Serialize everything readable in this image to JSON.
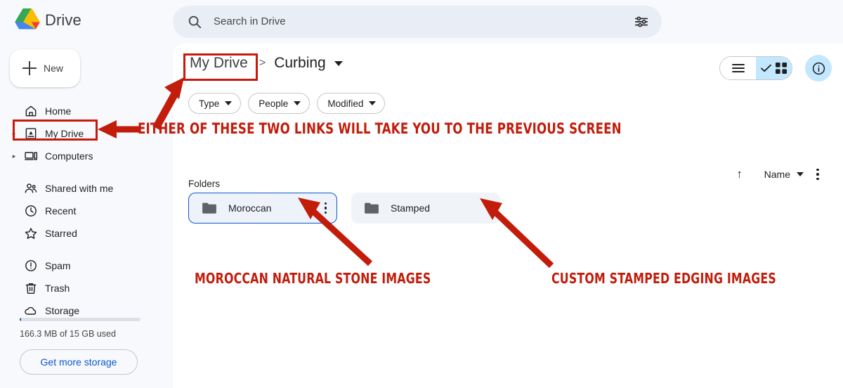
{
  "app": {
    "name": "Drive",
    "logo_icon": "google-drive-logo"
  },
  "search": {
    "placeholder": "Search in Drive",
    "value": "",
    "search_icon": "search-icon",
    "filter_icon": "tune-icon"
  },
  "sidebar": {
    "new_button": {
      "label": "New",
      "icon": "plus-icon"
    },
    "items": [
      {
        "label": "Home",
        "icon": "home-icon",
        "caret": false,
        "selected": false
      },
      {
        "label": "My Drive",
        "icon": "my-drive-icon",
        "caret": true,
        "selected": true
      },
      {
        "label": "Computers",
        "icon": "computers-icon",
        "caret": true,
        "selected": false
      },
      {
        "label": "Shared with me",
        "icon": "people-icon",
        "caret": false,
        "selected": false
      },
      {
        "label": "Recent",
        "icon": "clock-icon",
        "caret": false,
        "selected": false
      },
      {
        "label": "Starred",
        "icon": "star-icon",
        "caret": false,
        "selected": false
      },
      {
        "label": "Spam",
        "icon": "spam-icon",
        "caret": false,
        "selected": false
      },
      {
        "label": "Trash",
        "icon": "trash-icon",
        "caret": false,
        "selected": false
      },
      {
        "label": "Storage",
        "icon": "cloud-icon",
        "caret": false,
        "selected": false
      }
    ],
    "storage": {
      "usage_text": "166.3 MB of 15 GB used",
      "percent": 1,
      "bar_color": "#0b57d0",
      "button_label": "Get more storage"
    }
  },
  "main": {
    "breadcrumb": {
      "root": "My Drive",
      "separator": ">",
      "current": "Curbing",
      "dropdown_icon": "chevron-down-icon"
    },
    "filter_chips": [
      {
        "label": "Type",
        "icon": "chevron-down-icon"
      },
      {
        "label": "People",
        "icon": "chevron-down-icon"
      },
      {
        "label": "Modified",
        "icon": "chevron-down-icon"
      }
    ],
    "view_toggle": {
      "list_icon": "list-view-icon",
      "grid_icon": "grid-view-icon",
      "check_icon": "check-icon",
      "selected": "grid",
      "selected_bg": "#c2e7ff"
    },
    "info_button": {
      "icon": "info-icon",
      "bg": "#c2e7ff"
    },
    "sort": {
      "direction_icon": "arrow-up-icon",
      "field_label": "Name",
      "field_caret_icon": "chevron-down-icon",
      "more_icon": "more-vertical-icon"
    },
    "section_label": "Folders",
    "folders": [
      {
        "name": "Moroccan",
        "icon": "folder-icon",
        "selected": true,
        "menu_icon": "more-vertical-icon"
      },
      {
        "name": "Stamped",
        "icon": "folder-icon",
        "selected": false,
        "menu_icon": "more-vertical-icon"
      }
    ]
  },
  "annotations": {
    "color": "#c21c0b",
    "box_color": "#c9190b",
    "callouts": [
      {
        "text": "EITHER OF THESE TWO LINKS WILL TAKE YOU TO THE PREVIOUS SCREEN"
      },
      {
        "text": "MOROCCAN NATURAL STONE IMAGES"
      },
      {
        "text": "CUSTOM STAMPED EDGING IMAGES"
      }
    ],
    "highlight_boxes": [
      {
        "target": "breadcrumb-root-my-drive"
      },
      {
        "target": "sidebar-item-my-drive"
      }
    ],
    "arrows": [
      {
        "from": "annotation-text",
        "to": "breadcrumb-root-my-drive",
        "direction": "up-right"
      },
      {
        "from": "annotation-text",
        "to": "sidebar-item-my-drive",
        "direction": "left"
      },
      {
        "from": "moroccan-caption",
        "to": "folder-moroccan",
        "direction": "up-left"
      },
      {
        "from": "stamped-caption",
        "to": "folder-stamped",
        "direction": "up-left"
      }
    ]
  }
}
